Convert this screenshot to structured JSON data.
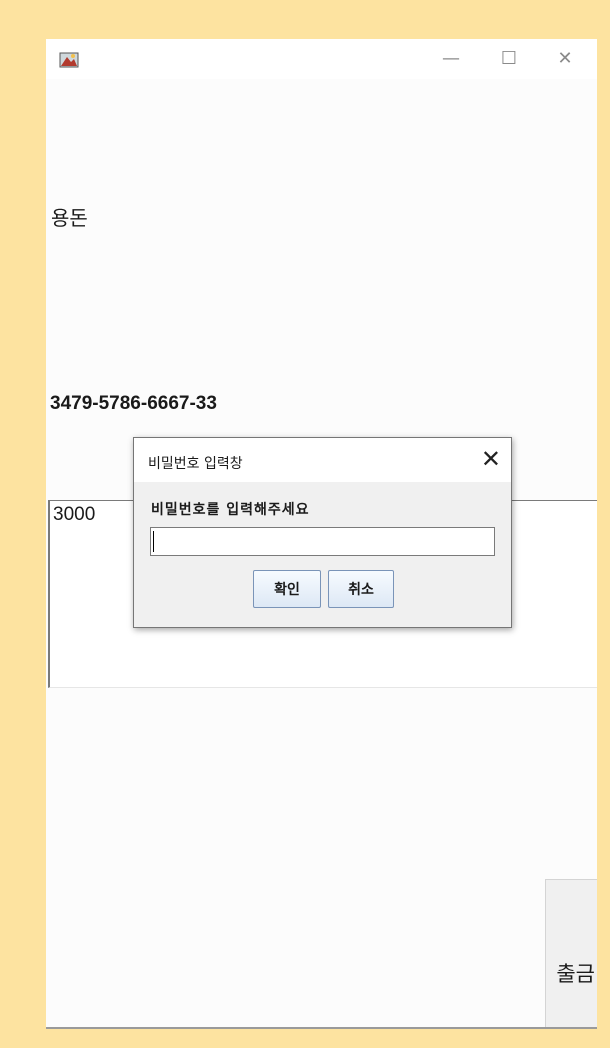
{
  "window": {
    "minimize_glyph": "—",
    "maximize_glyph": "☐",
    "close_glyph": "✕"
  },
  "main": {
    "name_label": "용돈",
    "account_label": "3479-5786-6667-33",
    "amount_value": "3000",
    "withdraw_button": "출금"
  },
  "dialog": {
    "title": "비밀번호 입력창",
    "close_glyph": "✕",
    "message": "비밀번호를 입력해주세요",
    "input_value": "",
    "ok_button": "확인",
    "cancel_button": "취소"
  },
  "colors": {
    "background": "#fde3a0",
    "window": "#ffffff",
    "dialog": "#f0f0f0",
    "button_border": "#7a94b8"
  }
}
